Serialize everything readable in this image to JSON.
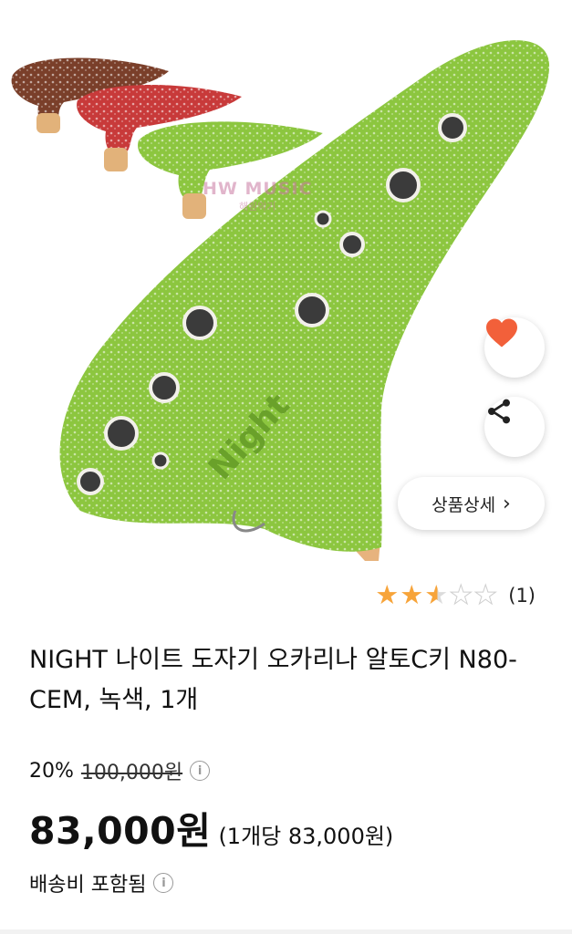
{
  "product": {
    "title": "NIGHT 나이트 도자기 오카리나 알토C키 N80-CEM, 녹색, 1개",
    "watermark": "HW MUSIC",
    "watermark_sub": "해원악기",
    "engraving": "Night"
  },
  "actions": {
    "favorite_icon": "heart-icon",
    "share_icon": "share-icon",
    "detail_label": "상품상세",
    "detail_chevron": "›"
  },
  "rating": {
    "stars": 2.5,
    "max": 5,
    "review_count": "(1)"
  },
  "price": {
    "discount": "20%",
    "original": "100,000원",
    "sale": "83,000원",
    "unit": "(1개당 83,000원)"
  },
  "shipping": {
    "label": "배송비 포함됨"
  },
  "colors": {
    "ocarina_green": "#8cc63f",
    "star": "#f7a43a",
    "heart": "#f2603a"
  }
}
